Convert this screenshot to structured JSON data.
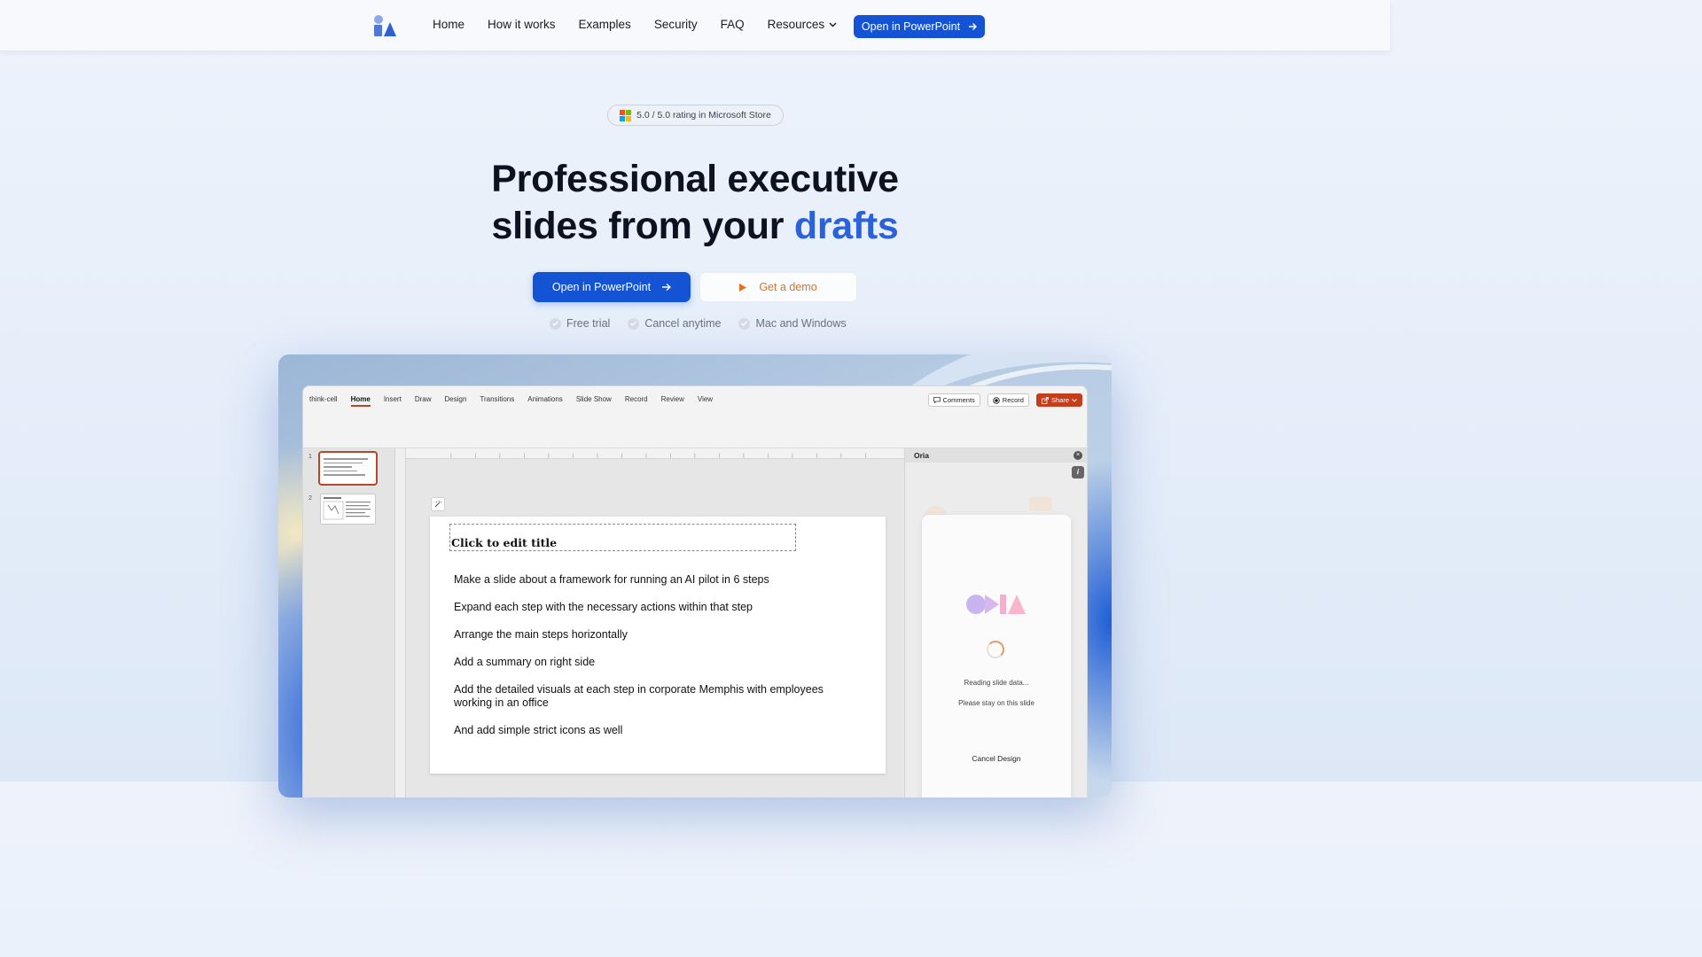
{
  "nav": {
    "links": [
      "Home",
      "How it works",
      "Examples",
      "Security",
      "FAQ"
    ],
    "resources_label": "Resources",
    "cta_label": "Open in PowerPoint"
  },
  "rating": {
    "text": "5.0 / 5.0 rating in Microsoft Store"
  },
  "hero": {
    "headline_line1": "Professional executive",
    "headline_line2_prefix": "slides from your ",
    "headline_accent": "drafts",
    "primary_button": "Open in PowerPoint",
    "demo_button": "Get a demo",
    "checks": [
      "Free trial",
      "Cancel anytime",
      "Mac and Windows"
    ]
  },
  "app": {
    "ribbon_tabs": [
      "think-cell",
      "Home",
      "Insert",
      "Draw",
      "Design",
      "Transitions",
      "Animations",
      "Slide Show",
      "Record",
      "Review",
      "View"
    ],
    "active_tab": "Home",
    "comments_label": "Comments",
    "record_label": "Record",
    "share_label": "Share",
    "slide_numbers": [
      "1",
      "2"
    ],
    "slide": {
      "title_placeholder": "Click to edit title",
      "bullets": [
        "Make a slide about a framework for running an AI pilot in 6 steps",
        "Expand each step with the necessary actions within that step",
        "Arrange the main steps horizontally",
        "Add a summary on right side",
        "Add the detailed visuals at each step in corporate Memphis with employees working in an office",
        "And add simple strict icons as well"
      ]
    },
    "panel": {
      "title": "Oria",
      "status_line1": "Reading slide data...",
      "status_line2": "Please stay on this slide",
      "cancel_label": "Cancel Design"
    }
  },
  "colors": {
    "primary": "#1353d4",
    "accent_text": "#2b62dc",
    "demo_orange": "#e2701f",
    "share_red": "#c43e1c"
  }
}
